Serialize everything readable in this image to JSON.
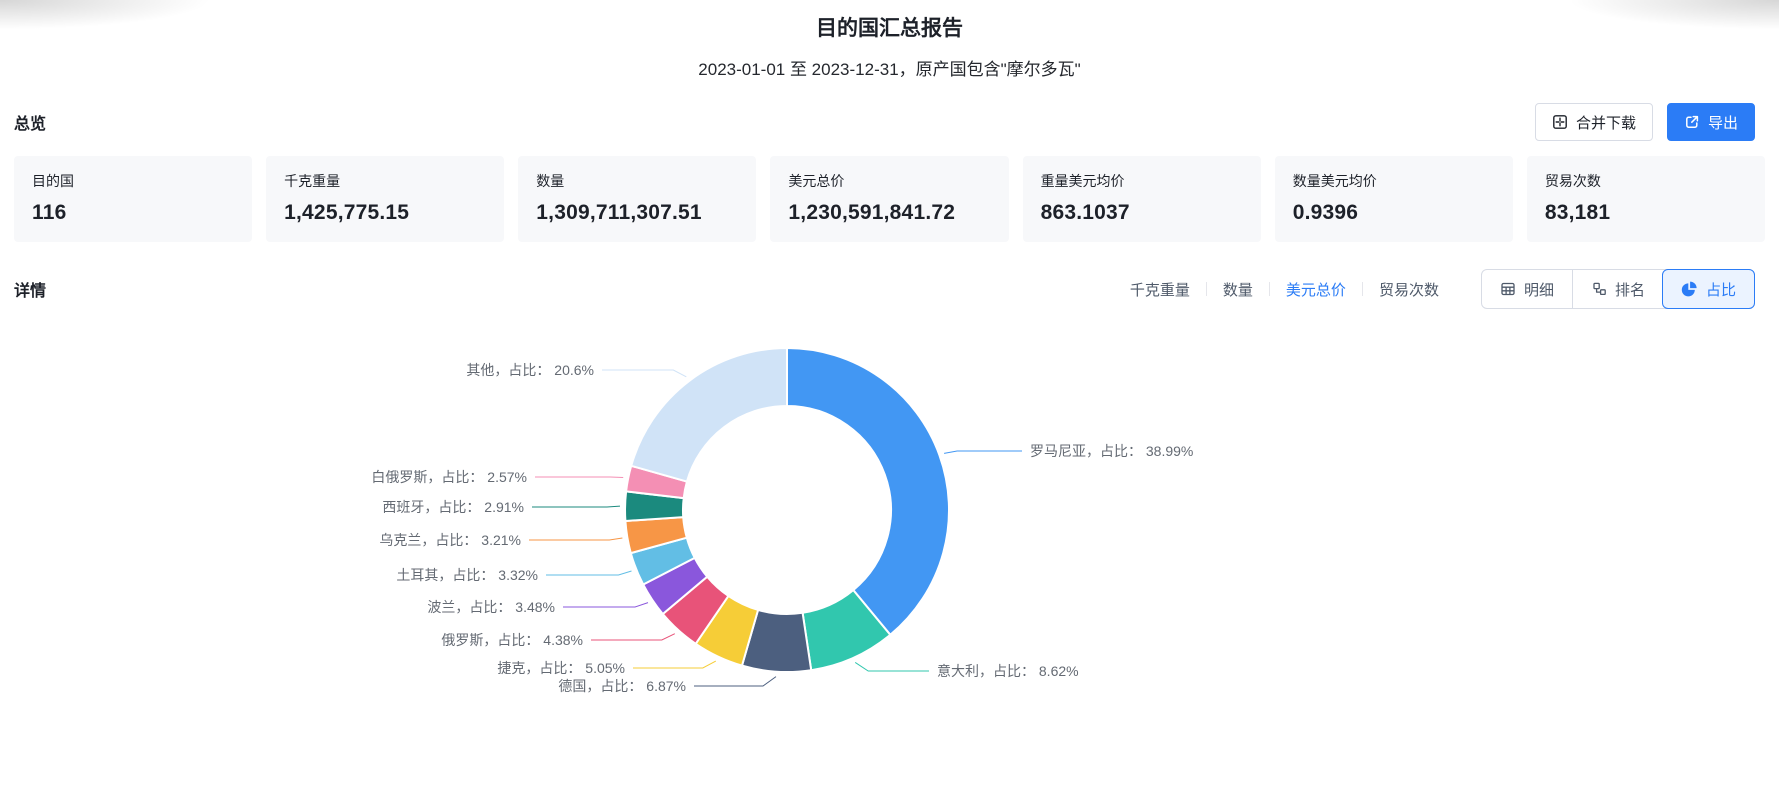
{
  "page": {
    "title": "目的国汇总报告",
    "subtitle": "2023-01-01 至 2023-12-31，原产国包含\"摩尔多瓦\""
  },
  "colors": {
    "accent": "#2B7CF6"
  },
  "overview": {
    "heading": "总览",
    "merge_download_label": "合并下载",
    "export_label": "导出",
    "cards": [
      {
        "label": "目的国",
        "value": "116"
      },
      {
        "label": "千克重量",
        "value": "1,425,775.15"
      },
      {
        "label": "数量",
        "value": "1,309,711,307.51"
      },
      {
        "label": "美元总价",
        "value": "1,230,591,841.72"
      },
      {
        "label": "重量美元均价",
        "value": "863.1037"
      },
      {
        "label": "数量美元均价",
        "value": "0.9396"
      },
      {
        "label": "贸易次数",
        "value": "83,181"
      }
    ]
  },
  "detail": {
    "heading": "详情",
    "metric_tabs": [
      {
        "label": "千克重量",
        "active": false
      },
      {
        "label": "数量",
        "active": false
      },
      {
        "label": "美元总价",
        "active": true
      },
      {
        "label": "贸易次数",
        "active": false
      }
    ],
    "view_buttons": [
      {
        "label": "明细",
        "icon": "table-icon",
        "active": false
      },
      {
        "label": "排名",
        "icon": "ranking-icon",
        "active": false
      },
      {
        "label": "占比",
        "icon": "pie-icon",
        "active": true
      }
    ]
  },
  "chart_data": {
    "type": "pie",
    "title": "",
    "label_format": "{name}，占比： {pct}%",
    "inner_radius_ratio": 0.64,
    "start_angle_deg": 0,
    "direction": "clockwise",
    "legend_position": "none",
    "slices": [
      {
        "name": "罗马尼亚",
        "pct": 38.99,
        "color": "#4297F3"
      },
      {
        "name": "意大利",
        "pct": 8.62,
        "color": "#31C7AE"
      },
      {
        "name": "德国",
        "pct": 6.87,
        "color": "#4C5F7F"
      },
      {
        "name": "捷克",
        "pct": 5.05,
        "color": "#F6CD37"
      },
      {
        "name": "俄罗斯",
        "pct": 4.38,
        "color": "#E85379"
      },
      {
        "name": "波兰",
        "pct": 3.48,
        "color": "#8A57DC"
      },
      {
        "name": "土耳其",
        "pct": 3.32,
        "color": "#62BEE5"
      },
      {
        "name": "乌克兰",
        "pct": 3.21,
        "color": "#F79646"
      },
      {
        "name": "西班牙",
        "pct": 2.91,
        "color": "#1B8A7E"
      },
      {
        "name": "白俄罗斯",
        "pct": 2.57,
        "color": "#F48FB4"
      },
      {
        "name": "其他",
        "pct": 20.6,
        "color": "#D0E3F7"
      }
    ]
  }
}
